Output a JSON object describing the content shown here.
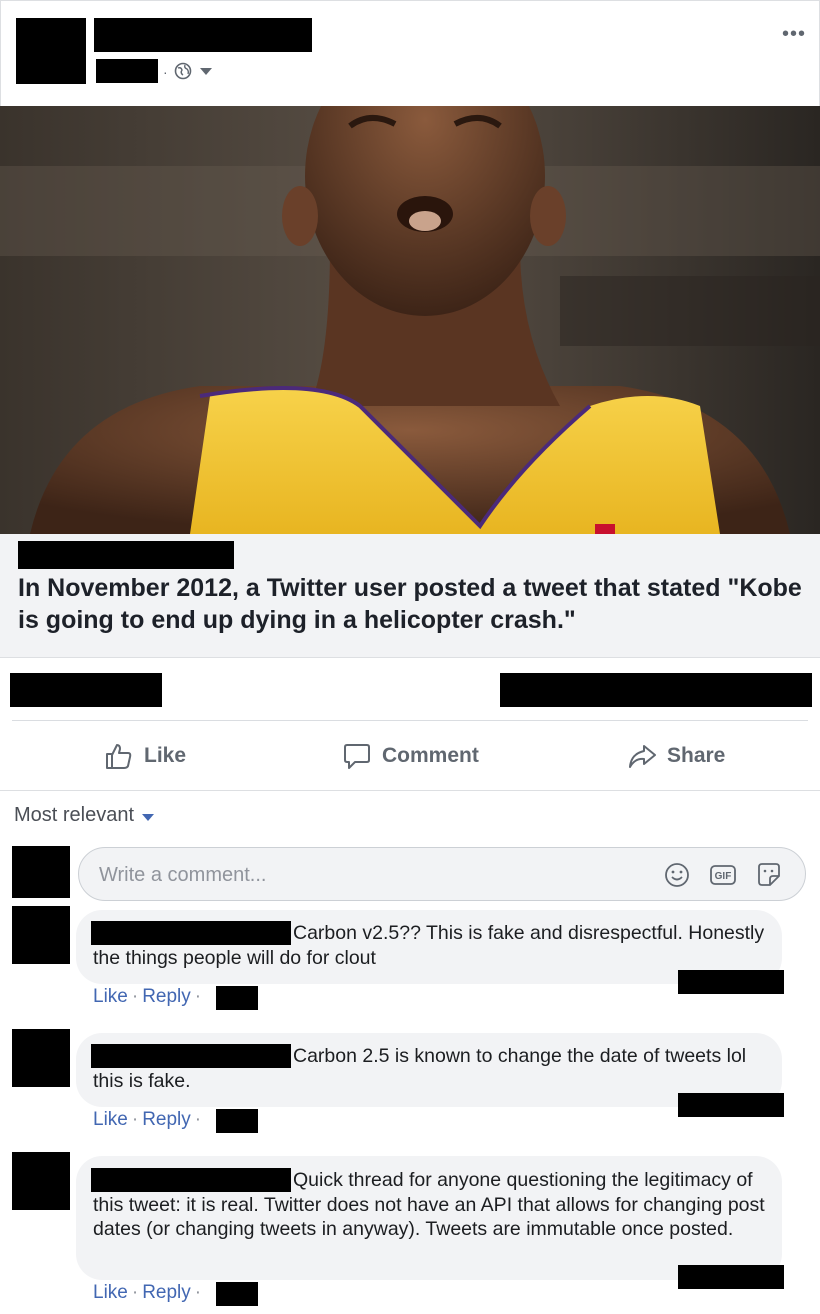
{
  "post": {
    "more_icon": "more-horizontal-icon",
    "privacy_icon": "globe-icon",
    "separator": "·"
  },
  "link_card": {
    "headline": "In November 2012, a Twitter user posted a tweet that stated \"Kobe is going to end up dying in a helicopter crash.\""
  },
  "actions": {
    "like_label": "Like",
    "comment_label": "Comment",
    "share_label": "Share"
  },
  "comments_section": {
    "sort_label": "Most relevant",
    "input_placeholder": "Write a comment...",
    "icons": [
      "emoji-icon",
      "gif-icon",
      "sticker-icon"
    ],
    "gif_text": "GIF"
  },
  "comments": [
    {
      "text": "Carbon v2.5?? This is fake and disrespectful. Honestly the things people will do for clout",
      "like_label": "Like",
      "reply_label": "Reply"
    },
    {
      "text": "Carbon 2.5 is known to change the date of tweets lol this is fake.",
      "like_label": "Like",
      "reply_label": "Reply"
    },
    {
      "text": "Quick thread for anyone questioning the legitimacy of this tweet: it is real. Twitter does not have an API that allows for changing post dates (or changing tweets in anyway). Tweets are immutable once posted.",
      "like_label": "Like",
      "reply_label": "Reply"
    }
  ],
  "colors": {
    "link_blue": "#4267b2",
    "muted_gray": "#606770",
    "card_bg": "#f2f3f5",
    "jersey_yellow": "#f7c62f"
  }
}
